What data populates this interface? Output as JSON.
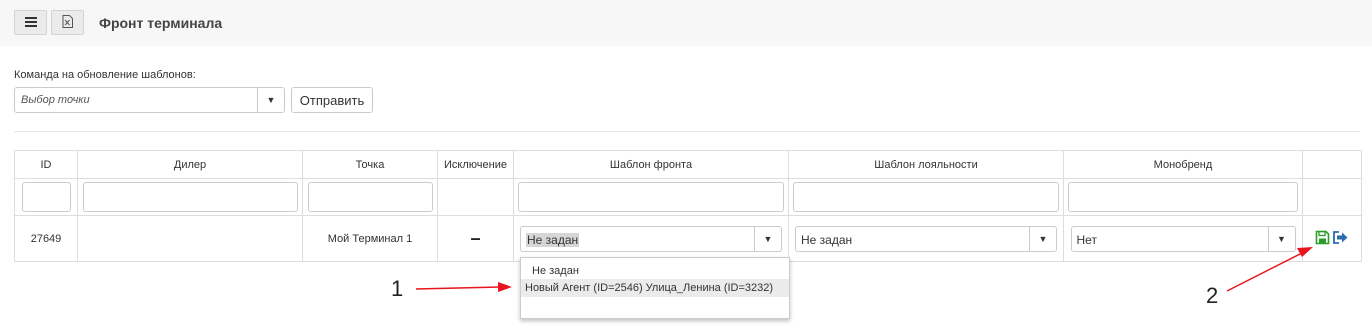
{
  "header": {
    "title": "Фронт терминала",
    "buttons": [
      {
        "icon": "menu-icon"
      },
      {
        "icon": "excel-export-icon"
      }
    ]
  },
  "update_command": {
    "label": "Команда на обновление шаблонов:",
    "point_select_placeholder": "Выбор точки",
    "send_label": "Отправить"
  },
  "table": {
    "columns": [
      "ID",
      "Дилер",
      "Точка",
      "Исключение",
      "Шаблон фронта",
      "Шаблон лояльности",
      "Монобренд",
      ""
    ],
    "rows": [
      {
        "id": "27649",
        "dealer": "",
        "point": "Мой Терминал 1",
        "exclusion": "–",
        "front_template": "Не задан",
        "loyalty_template": "Не задан",
        "monobrand": "Нет",
        "actions": [
          "save-icon",
          "logout-icon"
        ]
      }
    ]
  },
  "dropdown": {
    "options": [
      "Не задан",
      "Новый Агент (ID=2546) Улица_Ленина (ID=3232)"
    ]
  },
  "annotations": {
    "marker_1": "1",
    "marker_2": "2"
  },
  "colors": {
    "header_bg": "#f7f7f7",
    "save_icon": "#2a9d2a",
    "logout_icon": "#2b6cb0",
    "annotation_arrow": "#e8141e"
  }
}
